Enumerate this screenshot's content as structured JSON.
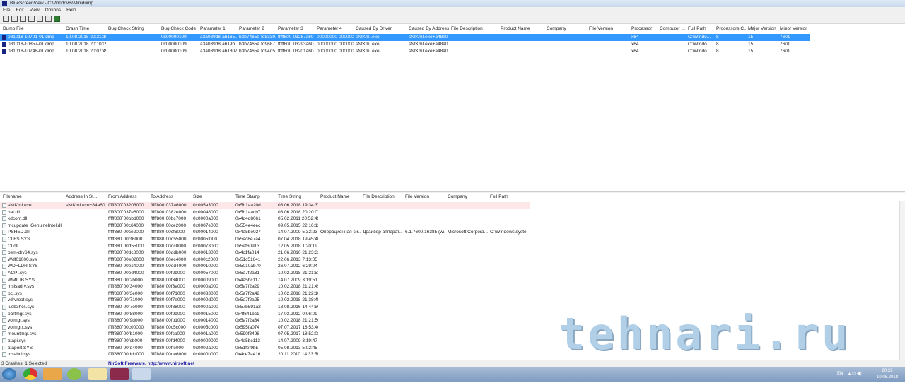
{
  "window": {
    "title": "BlueScreenView  -  C:\\Windows\\Minidump"
  },
  "menu": [
    "File",
    "Edit",
    "View",
    "Options",
    "Help"
  ],
  "toolbar": [
    "properties-icon",
    "save-icon",
    "html-report-icon",
    "copy-icon",
    "options-icon",
    "find-icon",
    "exit-icon"
  ],
  "crashes": {
    "columns": [
      "Dump File",
      "Crash Time",
      "Bug Check String",
      "Bug Check Code",
      "Parameter 1",
      "Parameter 2",
      "Parameter 3",
      "Parameter 4",
      "Caused By Driver",
      "Caused By Address",
      "File Description",
      "Product Name",
      "Company",
      "File Version",
      "Processor",
      "Computer ...",
      "Full Path",
      "Processors C...",
      "Major Version",
      "Minor Version"
    ],
    "rows": [
      [
        "081018-10701-01.dmp",
        "10.08.2018 20:21:10",
        "",
        "0x00000109",
        "a3a039d8`ab165...",
        "b3b7465e`fd8339...",
        "fffff800`03287a60",
        "00000000`000000...",
        "sNtKmI.exe",
        "sNtKmI.exe+a48a0",
        "",
        "",
        "",
        "",
        "x64",
        "",
        "C:\\Windo...",
        "8",
        "15",
        "7601"
      ],
      [
        "081018-10857-01.dmp",
        "10.08.2018 20:10:09",
        "",
        "0x00000109",
        "a3a039d8`ab19b...",
        "b3b7465e`fd9687...",
        "fffff800`03293a60",
        "00000000`000000...",
        "sNtKmI.exe",
        "sNtKmI.exe+a48a0",
        "",
        "",
        "",
        "",
        "x64",
        "",
        "C:\\Windo...",
        "8",
        "15",
        "7601"
      ],
      [
        "081018-10748-01.dmp",
        "10.08.2018 20:07:49",
        "",
        "0x00000109",
        "a3a039d8`ab1807...",
        "b3b7465e`fd94d5...",
        "fffff800`03201a60",
        "00000000`000000...",
        "sNtKmI.exe",
        "sNtKmI.exe+a48a0",
        "",
        "",
        "",
        "",
        "x64",
        "",
        "C:\\Windo...",
        "8",
        "15",
        "7601"
      ]
    ]
  },
  "drivers": {
    "columns": [
      "Filename",
      "Address In St...",
      "From Address",
      "To Address",
      "Size",
      "Time Stamp",
      "Time String",
      "Product Name",
      "File Description",
      "File Version",
      "Company",
      "Full Path"
    ],
    "rows": [
      [
        "sNtKmI.exe",
        "sNtKmI.exe+84a60",
        "fffff800`03203000",
        "fffff800`037a6000",
        "0x005a3000",
        "0x5b1aa20d",
        "08.06.2018 19:34:37"
      ],
      [
        "hal.dll",
        "",
        "fffff800`037e6000",
        "fffff800`0382e000",
        "0x00048000",
        "0x5b1aacb7",
        "08.06.2018 20:20:07"
      ],
      [
        "kdcom.dll",
        "",
        "fffff800`00bbd000",
        "fffff800`00bc7000",
        "0x0000a000",
        "0x4d4d8061",
        "05.02.2011 20:52:49"
      ],
      [
        "mcupdate_GenuineIntel.dll",
        "",
        "fffff880`00c64000",
        "fffff880`00ce2000",
        "0x0007e000",
        "0x554e4eec",
        "09.05.2015 22:16:12"
      ],
      [
        "PSHED.dll",
        "",
        "fffff880`00ce2000",
        "fffff880`00cf6000",
        "0x00014000",
        "0x4a5be027",
        "14.07.2009 5:32:23",
        "Операционная си...",
        "Драйвер аппарат...",
        "6.1.7600.16385 (wi...",
        "Microsoft Corpora...",
        "C:\\Windows\\syste..."
      ],
      [
        "CLFS.SYS",
        "",
        "fffff880`00cf6000",
        "fffff880`00d55000",
        "0x0005f000",
        "0x5ac8e7a4",
        "07.04.2018 19:45:40"
      ],
      [
        "CI.dll",
        "",
        "fffff880`00d55000",
        "fffff880`00dc8000",
        "0x00073000",
        "0x5af60913",
        "12.05.2018 1:20:19"
      ],
      [
        "oem-drv64.sys",
        "",
        "fffff880`00dc8000",
        "fffff880`00ddb000",
        "0x00013000",
        "0x4c1fa014",
        "21.06.2010 21:23:32"
      ],
      [
        "Wdf01000.sys",
        "",
        "fffff880`00e02000",
        "fffff880`00ec4000",
        "0x000c2000",
        "0x51c51641",
        "22.06.2013 7:13:05"
      ],
      [
        "WDFLDR.SYS",
        "",
        "fffff880`00ec4000",
        "fffff880`00ed4000",
        "0x00010000",
        "0x5010ab70",
        "26.07.2012 6:29:04"
      ],
      [
        "ACPI.sys",
        "",
        "fffff880`00ed4000",
        "fffff880`00f2b000",
        "0x00057000",
        "0x5a7f2a31",
        "10.02.2018 21:21:53"
      ],
      [
        "WMILIB.SYS",
        "",
        "fffff880`00f2b000",
        "fffff880`00f34000",
        "0x00009000",
        "0x4a5bc117",
        "14.07.2009 3:19:51"
      ],
      [
        "msisadrv.sys",
        "",
        "fffff880`00f34000",
        "fffff880`00f3e000",
        "0x0000a000",
        "0x5a7f2a29",
        "10.02.2018 21:21:45"
      ],
      [
        "pci.sys",
        "",
        "fffff880`00f3e000",
        "fffff880`00f71000",
        "0x00033000",
        "0x5a7f2a42",
        "10.02.2018 21:22:10"
      ],
      [
        "vdrvroot.sys",
        "",
        "fffff880`00f71000",
        "fffff880`00f7e000",
        "0x0000d000",
        "0x5a7f2a25",
        "10.02.2018 21:38:45"
      ],
      [
        "iusb3hcs.sys",
        "",
        "fffff880`00f7e000",
        "fffff880`00f88000",
        "0x0000a000",
        "0x57b591a2",
        "18.08.2016 14:44:50"
      ],
      [
        "partmgr.sys",
        "",
        "fffff880`00f88000",
        "fffff880`00f9d000",
        "0x00015000",
        "0x4f641bc1",
        "17.03.2012 0:06:09"
      ],
      [
        "volmgr.sys",
        "",
        "fffff880`00f9d000",
        "fffff880`00fb1000",
        "0x00014000",
        "0x5a7f2a34",
        "10.02.2018 21:21:56"
      ],
      [
        "volmgrx.sys",
        "",
        "fffff880`00c00000",
        "fffff880`00c5c000",
        "0x0005c000",
        "0x595fa074",
        "07.07.2017 18:53:40"
      ],
      [
        "mountmgr.sys",
        "",
        "fffff880`00fb1000",
        "fffff880`00fcb000",
        "0x0001a000",
        "0x590f3498",
        "07.05.2017 18:52:08"
      ],
      [
        "atapi.sys",
        "",
        "fffff880`00fcb000",
        "fffff880`00fd4000",
        "0x00009000",
        "0x4a5bc113",
        "14.07.2009 3:19:47"
      ],
      [
        "ataport.SYS",
        "",
        "fffff880`00fd4000",
        "fffff880`00ffe000",
        "0x0002a000",
        "0x51fef9b5",
        "05.08.2013 5:02:45"
      ],
      [
        "msahci.sys",
        "",
        "fffff880`00ddb000",
        "fffff880`00de6000",
        "0x0000b000",
        "0x4ce7a416",
        "20.11.2010 14:33:58"
      ]
    ]
  },
  "status": {
    "left": "3 Crashes, 1 Selected",
    "center": "NirSoft Freeware.  http://www.nirsoft.net"
  },
  "watermark": "tehnari.ru",
  "taskbar": {
    "lang": "EN",
    "time": "20:22",
    "date": "10.08.2018"
  },
  "colors": {
    "selection": "#3399ff",
    "highlight": "#fde7e9",
    "link": "#1a1aa6"
  }
}
